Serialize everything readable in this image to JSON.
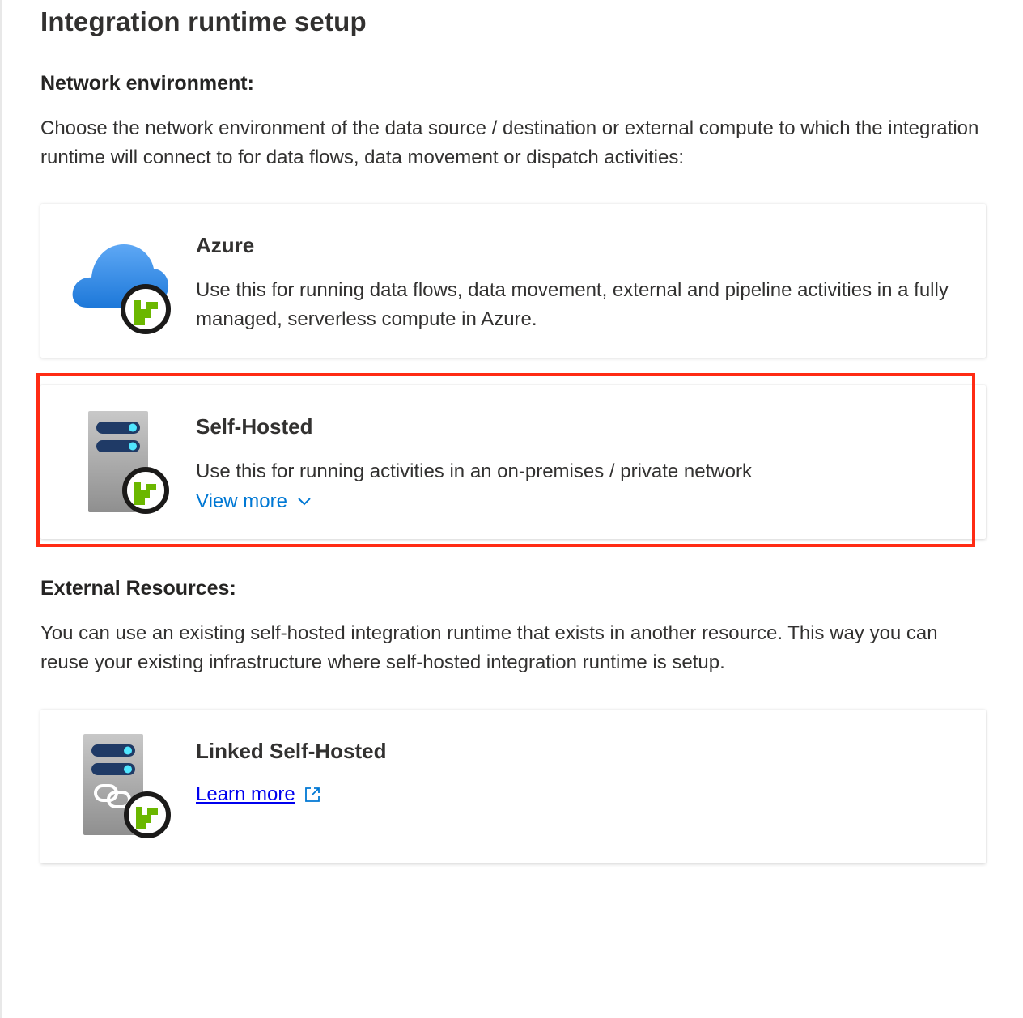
{
  "page": {
    "title": "Integration runtime setup"
  },
  "network_section": {
    "heading": "Network environment:",
    "description": "Choose the network environment of the data source / destination or external compute to which the integration runtime will connect to for data flows, data movement or dispatch activities:"
  },
  "options": {
    "azure": {
      "title": "Azure",
      "description": "Use this for running data flows, data movement, external and pipeline activities in a fully managed, serverless compute in Azure.",
      "icon": "azure-cloud-runtime-icon"
    },
    "self_hosted": {
      "title": "Self-Hosted",
      "description": "Use this for running activities in an on-premises / private network",
      "view_more_label": "View more",
      "icon": "server-runtime-icon"
    }
  },
  "external_section": {
    "heading": "External Resources:",
    "description": "You can use an existing self-hosted integration runtime that exists in another resource. This way you can reuse your existing infrastructure where self-hosted integration runtime is setup.",
    "linked": {
      "title": "Linked Self-Hosted",
      "learn_more_label": "Learn more",
      "icon": "linked-server-runtime-icon"
    }
  },
  "colors": {
    "link": "#0078d4",
    "highlight": "#ff2b14",
    "runtime_badge_green": "#6bb700"
  }
}
